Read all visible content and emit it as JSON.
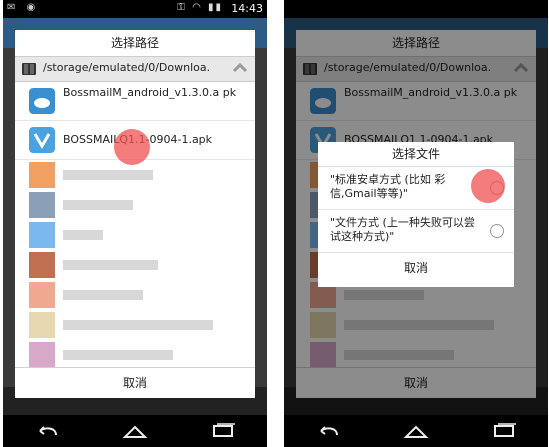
{
  "status": {
    "time": "14:43"
  },
  "file_dialog": {
    "title": "选择路径",
    "path": "/storage/emulated/0/Downloa.",
    "files": [
      {
        "name": "BossmailM_android_v1.3.0.a pk"
      },
      {
        "name": "BOSSMAILQ1.1-0904-1.apk"
      }
    ],
    "cancel_label": "取消"
  },
  "file_dialog_right": {
    "title": "选择路径",
    "path": "/storage/emulated/0/Downloa.",
    "files": [
      {
        "name": "BossmailM_android_v1.3.0.a pk"
      },
      {
        "name": "BOSSMAILQ1.1-0904-1.apk"
      }
    ],
    "cancel_label": "取消"
  },
  "type_dialog": {
    "title": "选择文件",
    "options": [
      {
        "label": "\"标准安卓方式 (比如 彩信,Gmail等等)\""
      },
      {
        "label": "\"文件方式 (上一种失败可以尝试这种方式)\""
      }
    ],
    "cancel_label": "取消"
  },
  "colors": {
    "accent": "#2b5b86",
    "touch": "#f05050"
  }
}
